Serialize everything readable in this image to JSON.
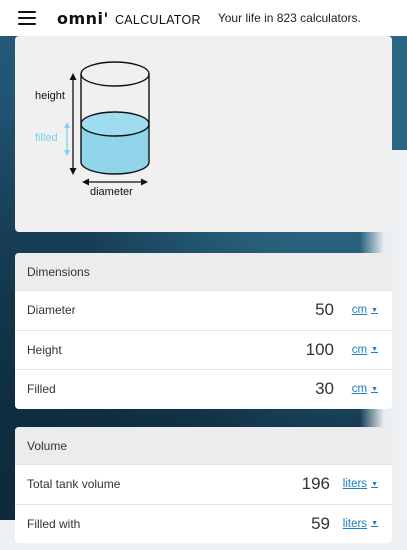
{
  "header": {
    "logo_main": "omni",
    "logo_mark": "'",
    "logo_sub": "CALCULATOR",
    "tagline": "Your life in 823 calculators."
  },
  "diagram": {
    "height_label": "height",
    "filled_label": "filled",
    "diameter_label": "diameter",
    "water_color": "#8fd4e8",
    "filled_color": "#7fd0ec"
  },
  "dimensions": {
    "title": "Dimensions",
    "rows": [
      {
        "label": "Diameter",
        "value": "50",
        "unit": "cm"
      },
      {
        "label": "Height",
        "value": "100",
        "unit": "cm"
      },
      {
        "label": "Filled",
        "value": "30",
        "unit": "cm"
      }
    ]
  },
  "volume": {
    "title": "Volume",
    "rows": [
      {
        "label": "Total tank volume",
        "value": "196",
        "unit": "liters"
      },
      {
        "label": "Filled with",
        "value": "59",
        "unit": "liters"
      }
    ]
  },
  "colors": {
    "link": "#1a7dc5",
    "card": "#f1f1f1"
  }
}
